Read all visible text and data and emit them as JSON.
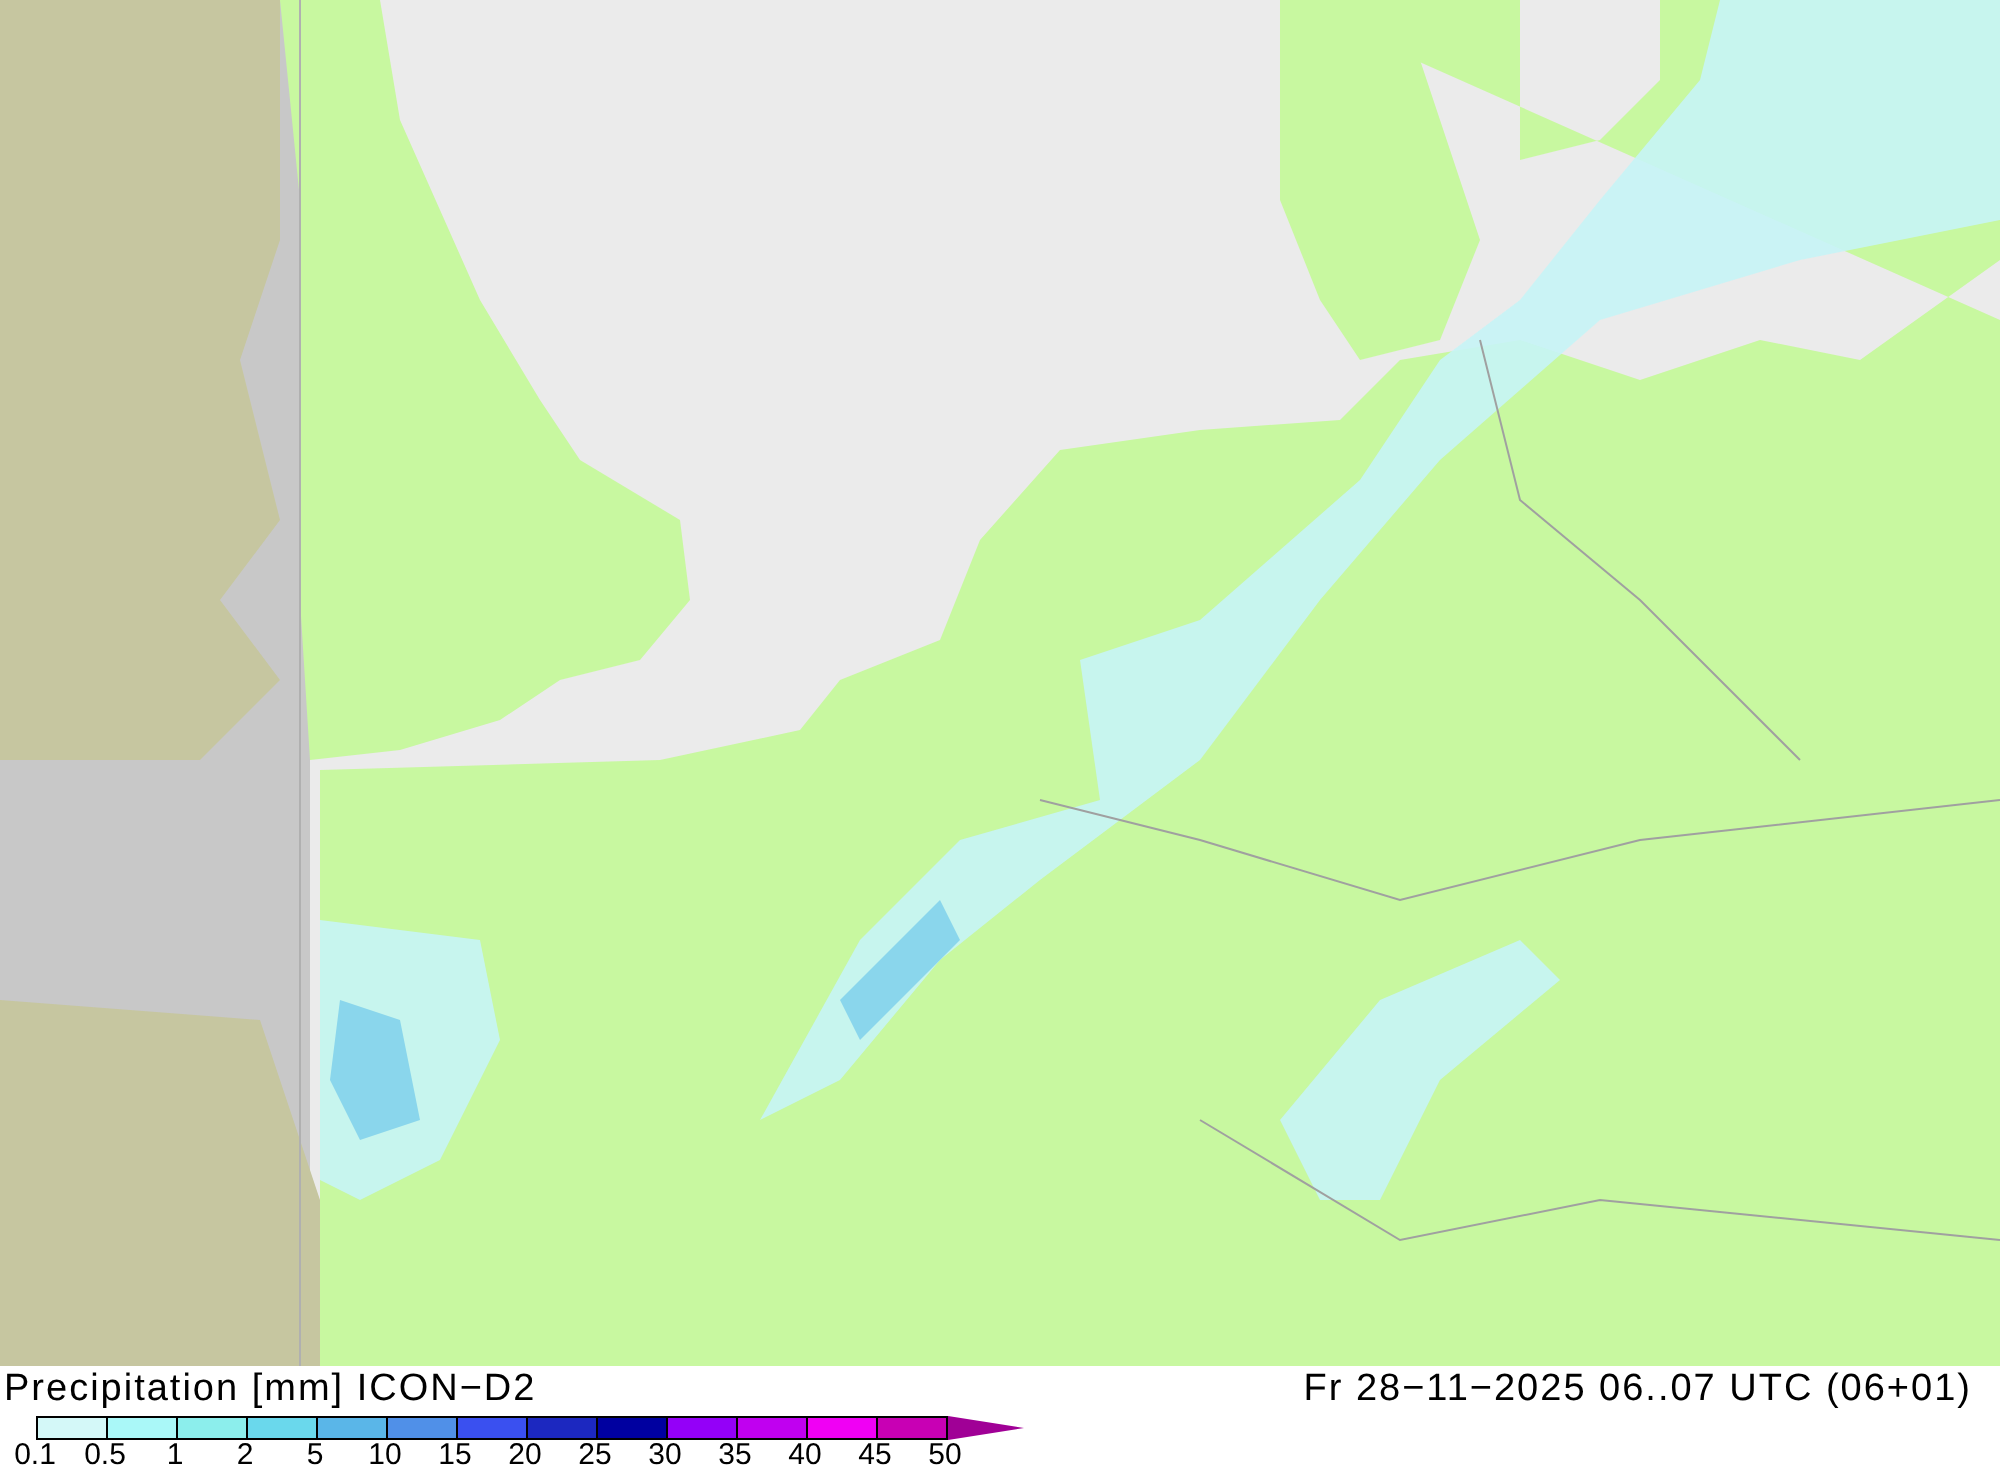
{
  "map": {
    "kind": "precipitation"
  },
  "footer": {
    "title": "Precipitation [mm] ICON−D2",
    "datetime": "Fr 28−11−2025 06..07 UTC (06+01)"
  },
  "legend": {
    "bins": [
      {
        "color": "#d4f8f8"
      },
      {
        "color": "#aaf8f8"
      },
      {
        "color": "#8ceeec"
      },
      {
        "color": "#6ad8ec"
      },
      {
        "color": "#5ab6e8"
      },
      {
        "color": "#5090e8"
      },
      {
        "color": "#3a50f0"
      },
      {
        "color": "#1c28c0"
      },
      {
        "color": "#0000a0"
      },
      {
        "color": "#9400f8"
      },
      {
        "color": "#c000f0"
      },
      {
        "color": "#f000f4"
      },
      {
        "color": "#c800b4"
      },
      {
        "color": "#a00096",
        "kind": "arrow"
      }
    ],
    "labels": [
      "0.1",
      "0.5",
      "1",
      "2",
      "5",
      "10",
      "15",
      "20",
      "25",
      "30",
      "35",
      "40",
      "45",
      "50"
    ]
  }
}
